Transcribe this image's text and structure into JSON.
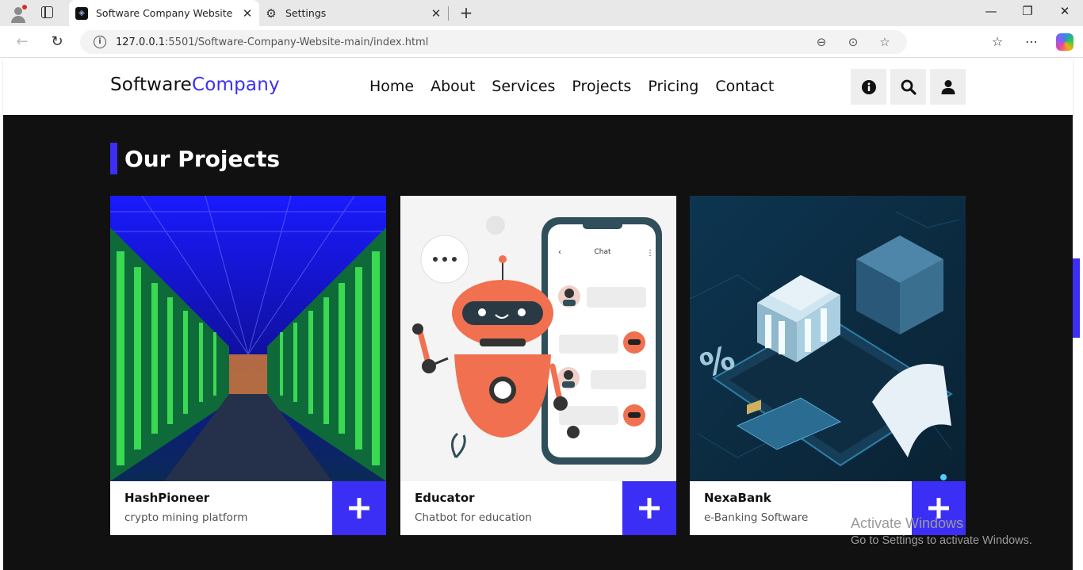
{
  "browser": {
    "tabs": [
      {
        "title": "Software Company Website",
        "active": true
      },
      {
        "title": "Settings",
        "active": false
      }
    ],
    "url_host": "127.0.0.1",
    "url_rest": ":5501/Software-Company-Website-main/index.html"
  },
  "site": {
    "logo_main": "Software",
    "logo_accent": "Company",
    "nav": [
      "Home",
      "About",
      "Services",
      "Projects",
      "Pricing",
      "Contact"
    ],
    "accent_color": "#3b2ff5"
  },
  "projects": {
    "title": "Our Projects",
    "cards": [
      {
        "name": "HashPioneer",
        "desc": "crypto mining platform"
      },
      {
        "name": "Educator",
        "desc": "Chatbot for education"
      },
      {
        "name": "NexaBank",
        "desc": "e-Banking Software"
      }
    ]
  },
  "phone_label": "Chat",
  "activate": {
    "line1": "Activate Windows",
    "line2": "Go to Settings to activate Windows."
  }
}
